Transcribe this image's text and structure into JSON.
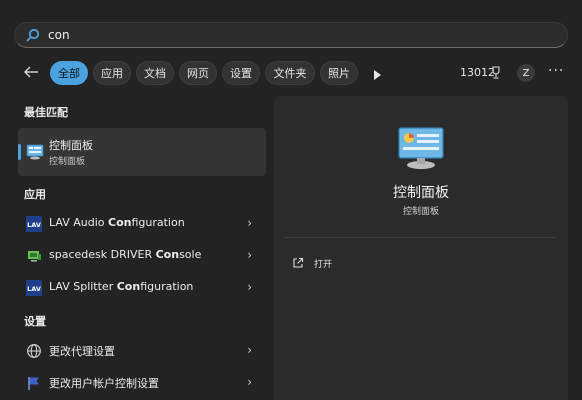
{
  "search": {
    "value": "con",
    "icon": "search-icon"
  },
  "filters": [
    {
      "label": "全部",
      "active": true
    },
    {
      "label": "应用",
      "active": false
    },
    {
      "label": "文档",
      "active": false
    },
    {
      "label": "网页",
      "active": false
    },
    {
      "label": "设置",
      "active": false
    },
    {
      "label": "文件夹",
      "active": false
    },
    {
      "label": "照片",
      "active": false
    }
  ],
  "header_right": {
    "points": "13012",
    "avatar_letter": "Z",
    "more": "···"
  },
  "best_match": {
    "section_title": "最佳匹配",
    "title": "控制面板",
    "subtitle": "控制面板"
  },
  "apps": {
    "section_title": "应用",
    "items": [
      {
        "pre": "LAV Audio ",
        "bold": "Con",
        "post": "figuration",
        "icon": "lav-icon"
      },
      {
        "pre": "spacedesk DRIVER ",
        "bold": "Con",
        "post": "sole",
        "icon": "spacedesk-icon"
      },
      {
        "pre": "LAV Splitter ",
        "bold": "Con",
        "post": "figuration",
        "icon": "lav-icon"
      }
    ]
  },
  "settings": {
    "section_title": "设置",
    "items": [
      {
        "label": "更改代理设置",
        "icon": "globe-icon"
      },
      {
        "label": "更改用户帐户控制设置",
        "icon": "flag-icon"
      }
    ]
  },
  "preview": {
    "name": "控制面板",
    "kind": "控制面板",
    "actions": [
      {
        "label": "打开",
        "icon": "open-external-icon"
      }
    ]
  },
  "colors": {
    "accent": "#4aa3df",
    "background": "#232323",
    "panel": "#2b2b2b"
  }
}
